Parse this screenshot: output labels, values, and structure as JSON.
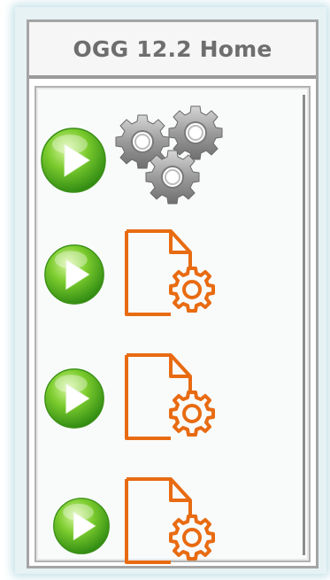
{
  "panel": {
    "title": "OGG 12.2 Home"
  },
  "process_list": [
    {
      "kind": "manager",
      "action_icon": "play-icon",
      "type_icon": "gears-icon"
    },
    {
      "kind": "parameter-file",
      "action_icon": "play-icon",
      "type_icon": "config-file-icon"
    },
    {
      "kind": "parameter-file",
      "action_icon": "play-icon",
      "type_icon": "config-file-icon"
    },
    {
      "kind": "parameter-file",
      "action_icon": "play-icon",
      "type_icon": "config-file-icon"
    }
  ],
  "colors": {
    "play_green": "#5fbf2a",
    "gear_gray": "#9a9a9a",
    "file_orange": "#e86b12",
    "title_text": "#6e6e6e"
  }
}
